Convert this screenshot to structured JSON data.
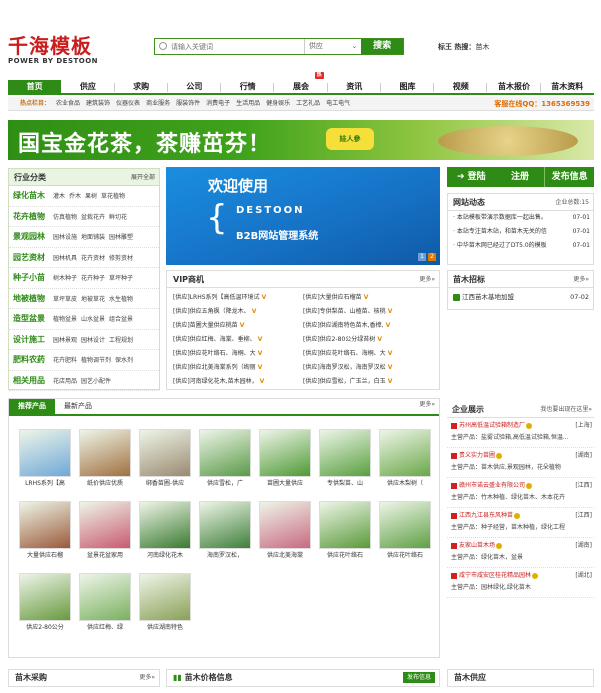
{
  "logo": {
    "text": "千海模板",
    "sub": "POWER BY DESTOON"
  },
  "search": {
    "placeholder": "请输入关键词",
    "scope": "供应",
    "button": "搜索"
  },
  "hot": {
    "label": "标王 热搜：",
    "word": "苗木"
  },
  "nav": [
    {
      "label": "首页"
    },
    {
      "label": "供应"
    },
    {
      "label": "求购"
    },
    {
      "label": "公司"
    },
    {
      "label": "行情"
    },
    {
      "label": "展会",
      "badge": "热"
    },
    {
      "label": "资讯"
    },
    {
      "label": "图库"
    },
    {
      "label": "视频"
    },
    {
      "label": "苗木报价"
    },
    {
      "label": "苗木资料"
    }
  ],
  "subnav": {
    "label": "热点栏目：",
    "items": [
      "农业食品",
      "建筑装饰",
      "仪器仪表",
      "商业服务",
      "服装饰件",
      "消费电子",
      "生活用品",
      "健身娱乐",
      "工艺礼品",
      "电工电气"
    ],
    "qq": "客服在线QQ：1365369539"
  },
  "banner": {
    "title": "国宝金花茶，茶赚茁芬！",
    "brand": "娃人參"
  },
  "categories": {
    "title": "行业分类",
    "more": "展开全部",
    "rows": [
      {
        "name": "绿化苗木",
        "subs": [
          "灌木",
          "乔木",
          "果树",
          "草花植物"
        ]
      },
      {
        "name": "花卉植物",
        "subs": [
          "仿真植物",
          "盆栽花卉",
          "鲜切花"
        ]
      },
      {
        "name": "景观园林",
        "subs": [
          "园林设施",
          "地面铺装",
          "园林雕塑"
        ]
      },
      {
        "name": "园艺资材",
        "subs": [
          "园林机具",
          "花卉资材",
          "修剪资材"
        ]
      },
      {
        "name": "种子小苗",
        "subs": [
          "树木种子",
          "花卉种子",
          "草坪种子"
        ]
      },
      {
        "name": "地被植物",
        "subs": [
          "草坪草皮",
          "地被草花",
          "水生植物"
        ]
      },
      {
        "name": "造型盆景",
        "subs": [
          "植物盆景",
          "山水盆景",
          "组合盆景"
        ]
      },
      {
        "name": "设计施工",
        "subs": [
          "园林景观",
          "园林设计",
          "工程规划"
        ]
      },
      {
        "name": "肥料农药",
        "subs": [
          "花卉肥料",
          "植物调节剂",
          "保水剂"
        ]
      },
      {
        "name": "相关用品",
        "subs": [
          "花店用品",
          "园艺小配件"
        ]
      }
    ]
  },
  "slide": {
    "welcome": "欢迎使用",
    "brand": "DESTOON",
    "system": "B2B网站管理系统",
    "pages": [
      "1",
      "2"
    ]
  },
  "vip": {
    "title": "VIP商机",
    "more": "更多»",
    "items": [
      "[供应]LRHS系列【高低温环境试",
      "[供应]大量供应石榴苗",
      "[供应]供应五角枫（降龙木、",
      "[供应]专供梨苗、山楂苗、核桃",
      "[供应]苗圃大量供应桃苗",
      "[供应]供应湖南特色苗木,香樟,",
      "[供应]供应红梅、海棠、垂柳、",
      "[供应]供应2-80公分绿苔树",
      "[供应]供应花叶络石、海桐、大",
      "[供应]供应花叶络石、海桐、大",
      "[供应]供应北美海棠系列（绚丽",
      "[供应]海南罗汉松，海南罗汉松",
      "[供应]河南绿化花木,苗木园林，",
      "[供应]供应雪松，广玉兰，白玉"
    ]
  },
  "login": {
    "login": "登陆",
    "register": "注册",
    "publish": "发布信息"
  },
  "news": {
    "title": "网站动态",
    "more": "企业总数:15",
    "items": [
      {
        "text": "· 本站模板带演示数据库一起出售。",
        "date": "07-01"
      },
      {
        "text": "· 本站专注苗木站，和苗木无关的信",
        "date": "07-01"
      },
      {
        "text": "· 中华苗木网已经过了DT5.0的模板",
        "date": "07-01"
      }
    ]
  },
  "bid": {
    "title": "苗木招标",
    "more": "更多»",
    "items": [
      {
        "text": "江西苗木基地加盟",
        "date": "07-02"
      }
    ]
  },
  "products": {
    "tabs": [
      "推荐产品",
      "最新产品"
    ],
    "more": "更多»",
    "items": [
      {
        "cap": "LRHS系列【高",
        "c": "#6fa8d8"
      },
      {
        "cap": "纸价供应优质",
        "c": "#a07040"
      },
      {
        "cap": "绑香苗圃-供应",
        "c": "#9a8a70"
      },
      {
        "cap": "供应雪松，广",
        "c": "#5a9a48"
      },
      {
        "cap": "苗圃大量供应",
        "c": "#4f9a35"
      },
      {
        "cap": "专供梨苗、山",
        "c": "#58a040"
      },
      {
        "cap": "供应木梨树（",
        "c": "#6aa84a"
      },
      {
        "cap": "大量供应石榴",
        "c": "#9a5a3a"
      },
      {
        "cap": "盆景花盆家用",
        "c": "#c85a70"
      },
      {
        "cap": "河南绿化花木",
        "c": "#3a7a30"
      },
      {
        "cap": "海南罗汉松，",
        "c": "#3f7f3a"
      },
      {
        "cap": "供应北美海棠",
        "c": "#c86a80"
      },
      {
        "cap": "供应花叶络石",
        "c": "#5a9a3a"
      },
      {
        "cap": "供应花叶络石",
        "c": "#5fa045"
      },
      {
        "cap": "供应2-80公分",
        "c": "#689a40"
      },
      {
        "cap": "供应红梅、绿",
        "c": "#7ab060"
      },
      {
        "cap": "供应湖南特色",
        "c": "#8aa058"
      }
    ]
  },
  "companies": {
    "title": "企业展示",
    "more": "我也要出现在这里»",
    "items": [
      {
        "name": "苏州高低温试验箱制造厂",
        "region": "[上海]",
        "main": "主营产品：盐雾试验箱,高低温试验箱,恒温..."
      },
      {
        "name": "贵义实力苗圃",
        "region": "[湖南]",
        "main": "主营产品：苗木供应,景观园林，花朵植物"
      },
      {
        "name": "赣州市诺云盛业有限公司",
        "region": "[江西]",
        "main": "主营产品：竹木种植、绿化苗木、木本花卉"
      },
      {
        "name": "江西九江县东风种苗",
        "region": "[江西]",
        "main": "主营产品：种子经营，苗木种植，绿化工程"
      },
      {
        "name": "友家山苗木场",
        "region": "[湖南]",
        "main": "主营产品：绿化苗木，盆景"
      },
      {
        "name": "咸宁市咸安区桂花精品园林",
        "region": "[湖北]",
        "main": "主营产品：园林绿化,绿化苗木"
      }
    ]
  },
  "bottom": {
    "buy": "苗木采购",
    "buy_more": "更多»",
    "price": "苗木价格信息",
    "publish": "发布信息",
    "supply": "苗木供应"
  },
  "colors": {
    "accent": "#2e8b16",
    "logo": "#c81e1e",
    "qq": "#e06b00"
  }
}
